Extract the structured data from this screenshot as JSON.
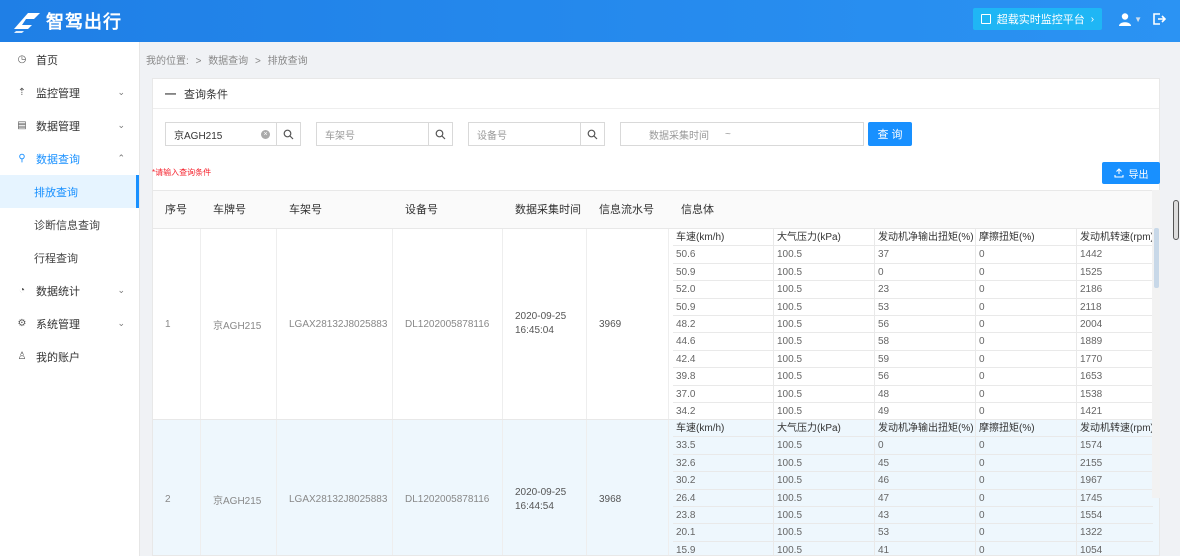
{
  "app": {
    "name": "智驾出行",
    "monitor_button": "超载实时监控平台",
    "monitor_arrow": "›"
  },
  "sidebar": {
    "items": [
      {
        "label": "首页",
        "icon": "clock-icon"
      },
      {
        "label": "监控管理",
        "icon": "upload-icon",
        "chevron": "⌄"
      },
      {
        "label": "数据管理",
        "icon": "table-icon",
        "chevron": "⌄"
      },
      {
        "label": "数据查询",
        "icon": "search-icon",
        "chevron": "⌃"
      },
      {
        "label": "数据统计",
        "icon": "pie-icon",
        "chevron": "⌄"
      },
      {
        "label": "系统管理",
        "icon": "gear-icon",
        "chevron": "⌄"
      },
      {
        "label": "我的账户",
        "icon": "user-icon"
      }
    ],
    "subitems": [
      "排放查询",
      "诊断信息查询",
      "行程查询"
    ]
  },
  "breadcrumb": {
    "prefix": "我的位置:",
    "sep": ">",
    "level1": "数据查询",
    "level2": "排放查询"
  },
  "query": {
    "title": "查询条件",
    "collapse": "—",
    "plate_value": "京AGH215",
    "frame_placeholder": "车架号",
    "device_placeholder": "设备号",
    "time_placeholder": "数据采集时间",
    "time_sep": "~",
    "query_button": "查 询",
    "hint": "*请输入查询条件",
    "export_button": "导出"
  },
  "table": {
    "headers": [
      "序号",
      "车牌号",
      "车架号",
      "设备号",
      "数据采集时间",
      "信息流水号",
      "信息体"
    ],
    "inner_headers": [
      "车速(km/h)",
      "大气压力(kPa)",
      "发动机净输出扭矩(%)",
      "摩擦扭矩(%)",
      "发动机转速(rpm)"
    ],
    "rows": [
      {
        "index": "1",
        "plate": "京AGH215",
        "frame": "LGAX28132J8025883",
        "device": "DL1202005878116",
        "time_date": "2020-09-25",
        "time_clock": "16:45:04",
        "serial": "3969",
        "info": [
          [
            "50.6",
            "100.5",
            "37",
            "0",
            "1442"
          ],
          [
            "50.9",
            "100.5",
            "0",
            "0",
            "1525"
          ],
          [
            "52.0",
            "100.5",
            "23",
            "0",
            "2186"
          ],
          [
            "50.9",
            "100.5",
            "53",
            "0",
            "2118"
          ],
          [
            "48.2",
            "100.5",
            "56",
            "0",
            "2004"
          ],
          [
            "44.6",
            "100.5",
            "58",
            "0",
            "1889"
          ],
          [
            "42.4",
            "100.5",
            "59",
            "0",
            "1770"
          ],
          [
            "39.8",
            "100.5",
            "56",
            "0",
            "1653"
          ],
          [
            "37.0",
            "100.5",
            "48",
            "0",
            "1538"
          ],
          [
            "34.2",
            "100.5",
            "49",
            "0",
            "1421"
          ]
        ]
      },
      {
        "index": "2",
        "plate": "京AGH215",
        "frame": "LGAX28132J8025883",
        "device": "DL1202005878116",
        "time_date": "2020-09-25",
        "time_clock": "16:44:54",
        "serial": "3968",
        "info": [
          [
            "33.5",
            "100.5",
            "0",
            "0",
            "1574"
          ],
          [
            "32.6",
            "100.5",
            "45",
            "0",
            "2155"
          ],
          [
            "30.2",
            "100.5",
            "46",
            "0",
            "1967"
          ],
          [
            "26.4",
            "100.5",
            "47",
            "0",
            "1745"
          ],
          [
            "23.8",
            "100.5",
            "43",
            "0",
            "1554"
          ],
          [
            "20.1",
            "100.5",
            "53",
            "0",
            "1322"
          ],
          [
            "15.9",
            "100.5",
            "41",
            "0",
            "1054"
          ]
        ]
      }
    ]
  }
}
